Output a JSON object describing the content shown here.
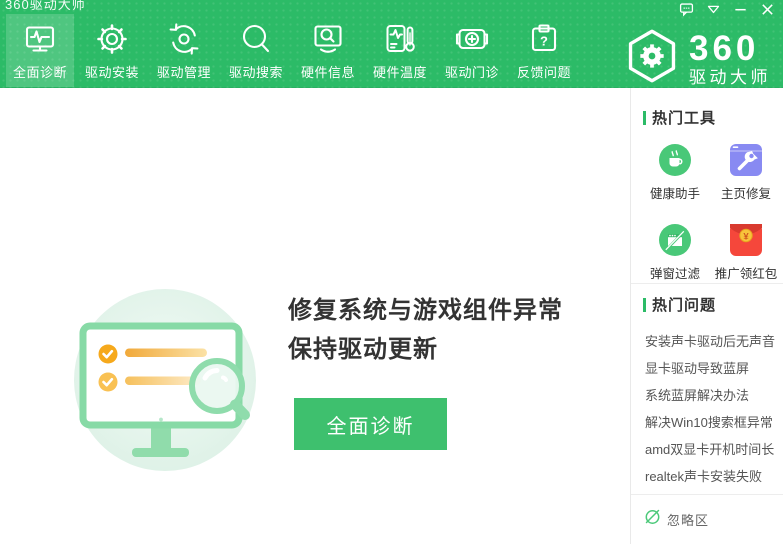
{
  "window": {
    "title": "360驱动大师",
    "controls": {
      "feedback": "feedback-bubble",
      "menu": "main-menu",
      "minimize": "minimize",
      "close": "close"
    }
  },
  "toolbar": {
    "items": [
      {
        "label": "全面诊断",
        "icon": "diagnosis-monitor-icon",
        "active": true
      },
      {
        "label": "驱动安装",
        "icon": "gear-icon",
        "active": false
      },
      {
        "label": "驱动管理",
        "icon": "refresh-sync-icon",
        "active": false
      },
      {
        "label": "驱动搜索",
        "icon": "search-icon",
        "active": false
      },
      {
        "label": "硬件信息",
        "icon": "monitor-magnifier-icon",
        "active": false
      },
      {
        "label": "硬件温度",
        "icon": "thermometer-icon",
        "active": false
      },
      {
        "label": "驱动门诊",
        "icon": "first-aid-kit-icon",
        "active": false
      },
      {
        "label": "反馈问题",
        "icon": "clipboard-question-icon",
        "active": false
      }
    ]
  },
  "logo": {
    "brand": "360",
    "subtitle": "驱动大师"
  },
  "main": {
    "headline_line1": "修复系统与游戏组件异常",
    "headline_line2": "保持驱动更新",
    "button_label": "全面诊断"
  },
  "sidebar": {
    "tools_header": "热门工具",
    "tools": [
      {
        "label": "健康助手",
        "icon": "health-cup-icon",
        "color": "#49c878"
      },
      {
        "label": "主页修复",
        "icon": "homepage-wrench-icon",
        "color": "#888af2"
      },
      {
        "label": "弹窗过滤",
        "icon": "popup-filter-icon",
        "color": "#49c878"
      },
      {
        "label": "推广领红包",
        "icon": "red-packet-icon",
        "color": "#f5473b"
      }
    ],
    "questions_header": "热门问题",
    "questions": [
      "安装声卡驱动后无声音",
      "显卡驱动导致蓝屏",
      "系统蓝屏解决办法",
      "解决Win10搜索框异常",
      "amd双显卡开机时间长",
      "realtek声卡安装失败"
    ],
    "ignore_label": "忽略区"
  },
  "colors": {
    "primary_green": "#2cbb67",
    "button_green": "#3ec06e",
    "illustration_green": "#8fdcac",
    "check_orange": "#f6a91c",
    "tool_purple": "#888af2",
    "tool_red": "#f5473b"
  }
}
